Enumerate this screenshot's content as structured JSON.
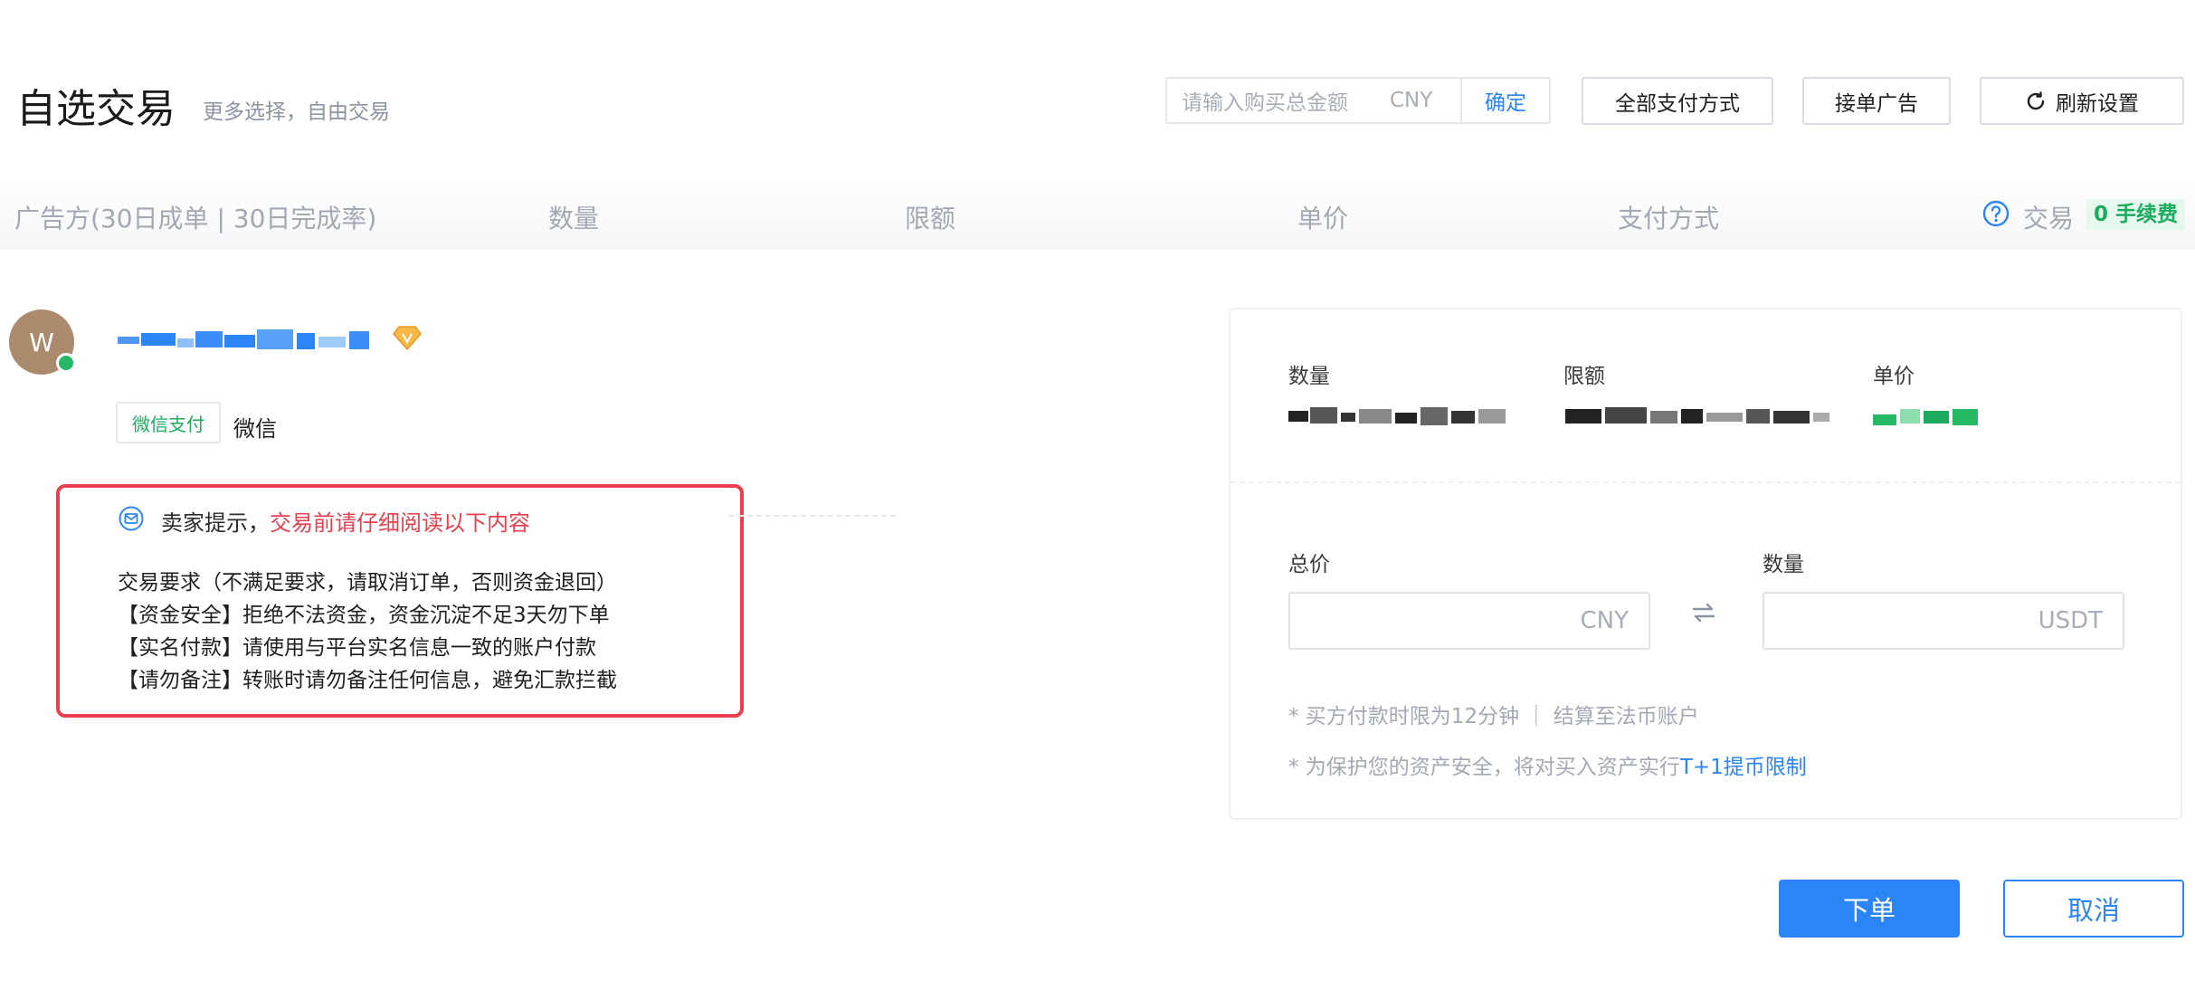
{
  "header": {
    "title": "自选交易",
    "subtitle": "更多选择，自由交易",
    "search": {
      "placeholder": "请输入购买总金额",
      "unit": "CNY",
      "confirm_label": "确定"
    },
    "payment_methods_label": "全部支付方式",
    "accept_ad_label": "接单广告",
    "refresh_label": "刷新设置"
  },
  "columns": {
    "advertiser": "广告方(30日成单 | 30日完成率)",
    "quantity": "数量",
    "limit": "限额",
    "price": "单价",
    "payment": "支付方式",
    "trade": "交易",
    "zero_fee": "0 手续费"
  },
  "seller": {
    "avatar_initial": "W",
    "payment_tag": "微信支付",
    "payment_text": "微信",
    "icons": [
      "online-status-dot",
      "vip-diamond-icon"
    ]
  },
  "notice": {
    "label": "卖家提示，",
    "warning": "交易前请仔细阅读以下内容",
    "lines": [
      "交易要求（不满足要求，请取消订单，否则资金退回）",
      "【资金安全】拒绝不法资金，资金沉淀不足3天勿下单",
      "【实名付款】请使用与平台实名信息一致的账户付款",
      "【请勿备注】转账时请勿备注任何信息，避免汇款拦截"
    ]
  },
  "panel": {
    "quantity_label": "数量",
    "limit_label": "限额",
    "price_label": "单价",
    "total_label": "总价",
    "amount_label": "数量",
    "total_unit": "CNY",
    "amount_unit": "USDT",
    "note_1": "* 买方付款时限为12分钟 ｜ 结算至法币账户",
    "note_2_prefix": "* 为保护您的资产安全，将对买入资产实行",
    "note_2_link": "T+1提币限制"
  },
  "actions": {
    "order_label": "下单",
    "cancel_label": "取消"
  },
  "colors": {
    "accent": "#2c85f5",
    "warning": "#e8404f",
    "success": "#1dab60"
  }
}
